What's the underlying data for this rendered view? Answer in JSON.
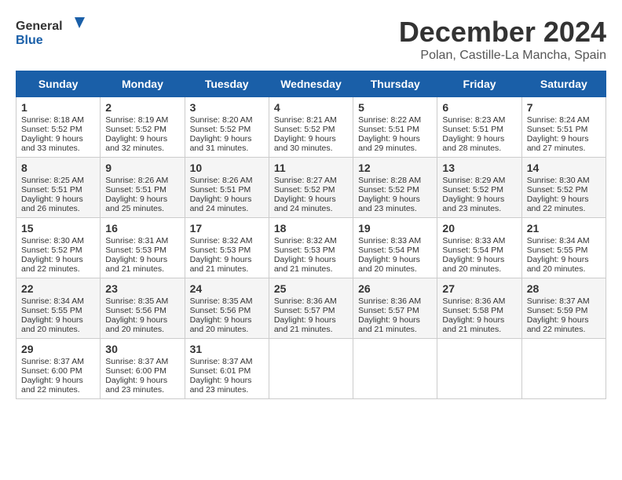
{
  "logo": {
    "line1": "General",
    "line2": "Blue"
  },
  "title": "December 2024",
  "subtitle": "Polan, Castille-La Mancha, Spain",
  "headers": [
    "Sunday",
    "Monday",
    "Tuesday",
    "Wednesday",
    "Thursday",
    "Friday",
    "Saturday"
  ],
  "weeks": [
    [
      {
        "day": "1",
        "sunrise": "8:18 AM",
        "sunset": "5:52 PM",
        "daylight": "9 hours and 33 minutes."
      },
      {
        "day": "2",
        "sunrise": "8:19 AM",
        "sunset": "5:52 PM",
        "daylight": "9 hours and 32 minutes."
      },
      {
        "day": "3",
        "sunrise": "8:20 AM",
        "sunset": "5:52 PM",
        "daylight": "9 hours and 31 minutes."
      },
      {
        "day": "4",
        "sunrise": "8:21 AM",
        "sunset": "5:52 PM",
        "daylight": "9 hours and 30 minutes."
      },
      {
        "day": "5",
        "sunrise": "8:22 AM",
        "sunset": "5:51 PM",
        "daylight": "9 hours and 29 minutes."
      },
      {
        "day": "6",
        "sunrise": "8:23 AM",
        "sunset": "5:51 PM",
        "daylight": "9 hours and 28 minutes."
      },
      {
        "day": "7",
        "sunrise": "8:24 AM",
        "sunset": "5:51 PM",
        "daylight": "9 hours and 27 minutes."
      }
    ],
    [
      {
        "day": "8",
        "sunrise": "8:25 AM",
        "sunset": "5:51 PM",
        "daylight": "9 hours and 26 minutes."
      },
      {
        "day": "9",
        "sunrise": "8:26 AM",
        "sunset": "5:51 PM",
        "daylight": "9 hours and 25 minutes."
      },
      {
        "day": "10",
        "sunrise": "8:26 AM",
        "sunset": "5:51 PM",
        "daylight": "9 hours and 24 minutes."
      },
      {
        "day": "11",
        "sunrise": "8:27 AM",
        "sunset": "5:52 PM",
        "daylight": "9 hours and 24 minutes."
      },
      {
        "day": "12",
        "sunrise": "8:28 AM",
        "sunset": "5:52 PM",
        "daylight": "9 hours and 23 minutes."
      },
      {
        "day": "13",
        "sunrise": "8:29 AM",
        "sunset": "5:52 PM",
        "daylight": "9 hours and 23 minutes."
      },
      {
        "day": "14",
        "sunrise": "8:30 AM",
        "sunset": "5:52 PM",
        "daylight": "9 hours and 22 minutes."
      }
    ],
    [
      {
        "day": "15",
        "sunrise": "8:30 AM",
        "sunset": "5:52 PM",
        "daylight": "9 hours and 22 minutes."
      },
      {
        "day": "16",
        "sunrise": "8:31 AM",
        "sunset": "5:53 PM",
        "daylight": "9 hours and 21 minutes."
      },
      {
        "day": "17",
        "sunrise": "8:32 AM",
        "sunset": "5:53 PM",
        "daylight": "9 hours and 21 minutes."
      },
      {
        "day": "18",
        "sunrise": "8:32 AM",
        "sunset": "5:53 PM",
        "daylight": "9 hours and 21 minutes."
      },
      {
        "day": "19",
        "sunrise": "8:33 AM",
        "sunset": "5:54 PM",
        "daylight": "9 hours and 20 minutes."
      },
      {
        "day": "20",
        "sunrise": "8:33 AM",
        "sunset": "5:54 PM",
        "daylight": "9 hours and 20 minutes."
      },
      {
        "day": "21",
        "sunrise": "8:34 AM",
        "sunset": "5:55 PM",
        "daylight": "9 hours and 20 minutes."
      }
    ],
    [
      {
        "day": "22",
        "sunrise": "8:34 AM",
        "sunset": "5:55 PM",
        "daylight": "9 hours and 20 minutes."
      },
      {
        "day": "23",
        "sunrise": "8:35 AM",
        "sunset": "5:56 PM",
        "daylight": "9 hours and 20 minutes."
      },
      {
        "day": "24",
        "sunrise": "8:35 AM",
        "sunset": "5:56 PM",
        "daylight": "9 hours and 20 minutes."
      },
      {
        "day": "25",
        "sunrise": "8:36 AM",
        "sunset": "5:57 PM",
        "daylight": "9 hours and 21 minutes."
      },
      {
        "day": "26",
        "sunrise": "8:36 AM",
        "sunset": "5:57 PM",
        "daylight": "9 hours and 21 minutes."
      },
      {
        "day": "27",
        "sunrise": "8:36 AM",
        "sunset": "5:58 PM",
        "daylight": "9 hours and 21 minutes."
      },
      {
        "day": "28",
        "sunrise": "8:37 AM",
        "sunset": "5:59 PM",
        "daylight": "9 hours and 22 minutes."
      }
    ],
    [
      {
        "day": "29",
        "sunrise": "8:37 AM",
        "sunset": "6:00 PM",
        "daylight": "9 hours and 22 minutes."
      },
      {
        "day": "30",
        "sunrise": "8:37 AM",
        "sunset": "6:00 PM",
        "daylight": "9 hours and 23 minutes."
      },
      {
        "day": "31",
        "sunrise": "8:37 AM",
        "sunset": "6:01 PM",
        "daylight": "9 hours and 23 minutes."
      },
      null,
      null,
      null,
      null
    ]
  ]
}
